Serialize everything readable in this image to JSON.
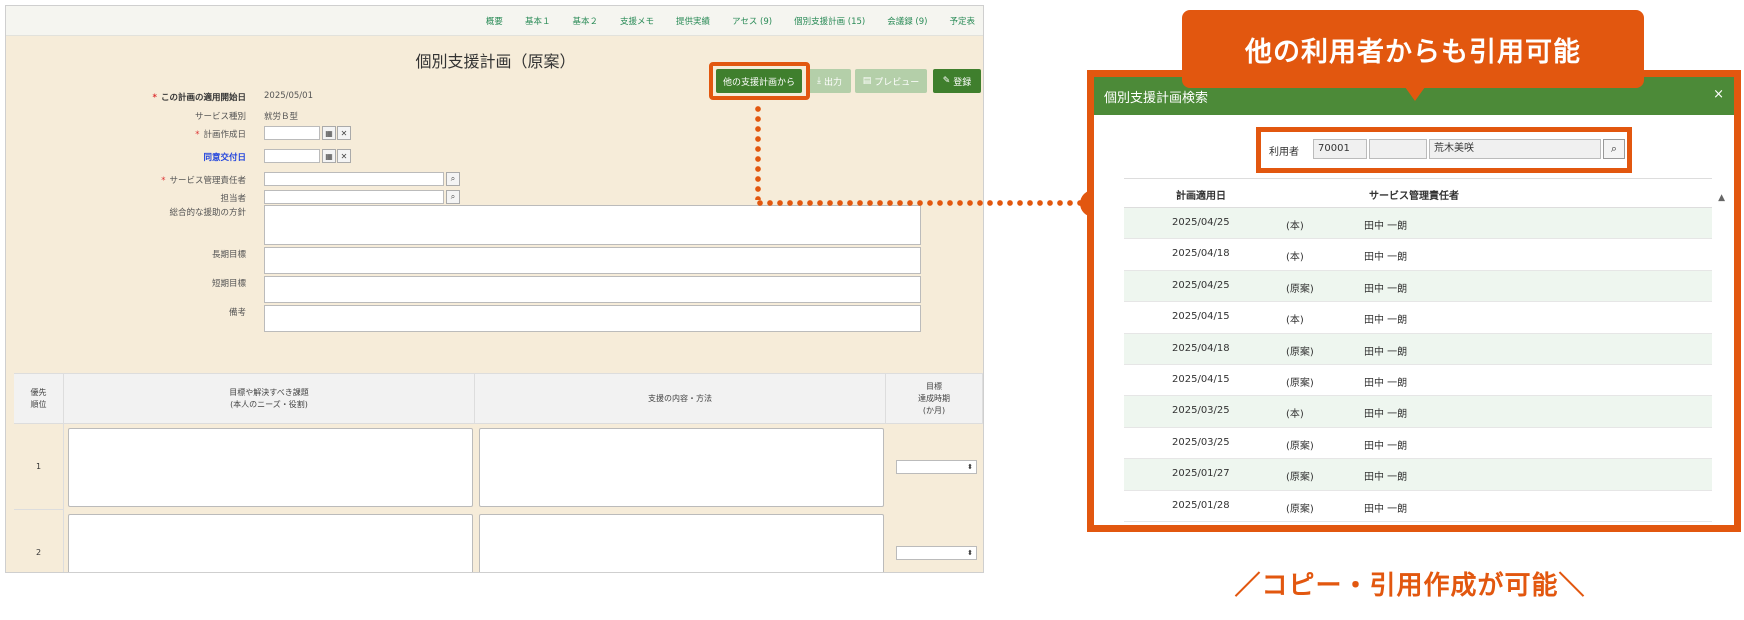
{
  "nav": [
    "概要",
    "基本１",
    "基本２",
    "支援メモ",
    "提供実績",
    "アセス (9)",
    "個別支援計画 (15)",
    "会議録 (9)",
    "予定表"
  ],
  "form": {
    "title": "個別支援計画（原案）",
    "buttons": {
      "other_plan": "他の支援計画から",
      "output": "出力",
      "preview": "プレビュー",
      "register": "登録"
    },
    "fields": {
      "start_date_label": "この計画の適用開始日",
      "start_date_value": "2025/05/01",
      "service_type_label": "サービス種別",
      "service_type_value": "就労Ｂ型",
      "created_date_label": "計画作成日",
      "consent_date_label": "同意交付日",
      "manager_label": "サービス管理責任者",
      "staff_label": "担当者",
      "policy_label": "総合的な援助の方針",
      "long_goal_label": "長期目標",
      "short_goal_label": "短期目標",
      "notes_label": "備考"
    },
    "grid": {
      "col_priority": "優先\n順位",
      "col_goal": "目標や解決すべき課題\n(本人のニーズ・役割)",
      "col_support": "支援の内容・方法",
      "col_period": "目標\n達成時期\n(か月)",
      "rows": [
        "1",
        "2"
      ]
    }
  },
  "modal": {
    "title": "個別支援計画検索",
    "close": "×",
    "search": {
      "label": "利用者",
      "id": "70001",
      "name": "荒木美咲"
    },
    "columns": [
      "計画適用日",
      "サービス管理責任者"
    ],
    "rows": [
      {
        "date": "2025/04/25",
        "type": "(本)",
        "manager": "田中 一朗"
      },
      {
        "date": "2025/04/18",
        "type": "(本)",
        "manager": "田中 一朗"
      },
      {
        "date": "2025/04/25",
        "type": "(原案)",
        "manager": "田中 一朗"
      },
      {
        "date": "2025/04/15",
        "type": "(本)",
        "manager": "田中 一朗"
      },
      {
        "date": "2025/04/18",
        "type": "(原案)",
        "manager": "田中 一朗"
      },
      {
        "date": "2025/04/15",
        "type": "(原案)",
        "manager": "田中 一朗"
      },
      {
        "date": "2025/03/25",
        "type": "(本)",
        "manager": "田中 一朗"
      },
      {
        "date": "2025/03/25",
        "type": "(原案)",
        "manager": "田中 一朗"
      },
      {
        "date": "2025/01/27",
        "type": "(原案)",
        "manager": "田中 一朗"
      },
      {
        "date": "2025/01/28",
        "type": "(原案)",
        "manager": "田中 一朗"
      }
    ]
  },
  "banner": "他の利用者からも引用可能",
  "caption": "／コピー・引用作成が可能＼",
  "colors": {
    "accent": "#e2570f",
    "green": "#4c8a38"
  }
}
